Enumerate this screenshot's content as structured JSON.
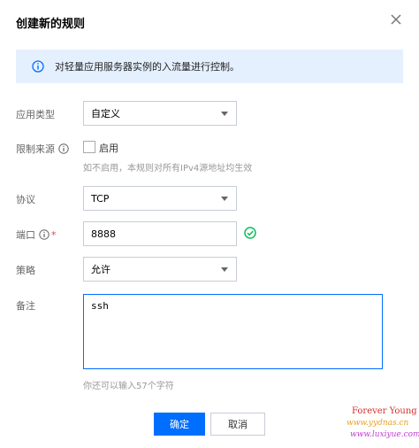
{
  "dialog": {
    "title": "创建新的规则",
    "close_icon": "close-icon"
  },
  "info": {
    "icon": "info-icon",
    "text": "对轻量应用服务器实例的入流量进行控制。"
  },
  "form": {
    "app_type": {
      "label": "应用类型",
      "value": "自定义"
    },
    "source": {
      "label": "限制来源",
      "help_icon": "info-circle-icon",
      "checkbox_label": "启用",
      "checked": false,
      "hint": "如不启用，本规则对所有IPv4源地址均生效"
    },
    "protocol": {
      "label": "协议",
      "value": "TCP"
    },
    "port": {
      "label": "端口",
      "help_icon": "info-circle-icon",
      "required_mark": "*",
      "value": "8888",
      "valid_icon": "check-circle-icon"
    },
    "policy": {
      "label": "策略",
      "value": "允许"
    },
    "note": {
      "label": "备注",
      "value": "ssh",
      "hint": "你还可以输入57个字符"
    }
  },
  "buttons": {
    "confirm": "确定",
    "cancel": "取消"
  },
  "watermark": {
    "line1": "Forever Young",
    "line2": "www.yydnas.cn",
    "line3": "www.luxiyue.com"
  },
  "colors": {
    "primary": "#006eff",
    "info_bg": "#e5f0ff",
    "success": "#0abf5b",
    "required": "#e54545"
  }
}
